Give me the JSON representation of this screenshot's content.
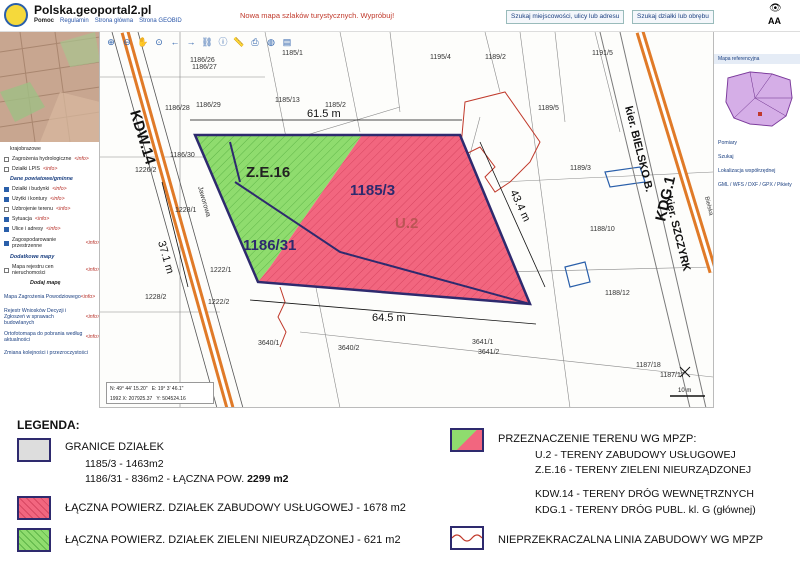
{
  "header": {
    "site_title": "Polska.geoportal2.pl",
    "links": [
      "Pomoc",
      "Regulamin",
      "Strona główna",
      "Strona GEOBID"
    ],
    "promo": "Nowa mapa szlaków turystycznych. Wypróbuj!",
    "search_button": "Szukaj miejscowości, ulicy lub adresu",
    "parcel_button": "Szukaj działki lub obrębu",
    "font_size_label": "AA"
  },
  "left_panel": {
    "layers_above": [
      "krajobrazowe"
    ],
    "layers": [
      {
        "label": "Zagrożenia hydrologiczne",
        "info": "<info>",
        "checked": false
      },
      {
        "label": "Działki LPIS",
        "info": "<info>",
        "checked": false
      }
    ],
    "section_district": "Dane powiatowe/gminne",
    "district_layers": [
      {
        "label": "Działki i budynki",
        "info": "<info>",
        "checked": true
      },
      {
        "label": "Użytki i kontury",
        "info": "<info>",
        "checked": true
      },
      {
        "label": "Uzbrojenie terenu",
        "info": "<info>",
        "checked": false
      },
      {
        "label": "Sytuacja",
        "info": "<info>",
        "checked": true
      },
      {
        "label": "Ulice i adresy",
        "info": "<info>",
        "checked": true
      },
      {
        "label": "Zagospodarowanie przestrzenne",
        "info": "<info>",
        "checked": true
      }
    ],
    "section_extra": "Dodatkowe mapy",
    "extra_layers": [
      {
        "label": "Mapa rejestru cen nieruchomości",
        "info": "<info>",
        "checked": false
      }
    ],
    "add_map_label": "Dodaj mapę",
    "links": [
      {
        "label": "Mapa Zagrożenia Powodziowego",
        "info": "<info>"
      },
      {
        "label": "Rejestr Wniosków Decyzji i Zgłoszeń w sprawach budowlanych",
        "info": "<info>"
      },
      {
        "label": "Ortofotomapa do pobrania według aktualności",
        "info": "<info>"
      }
    ],
    "footer_link": "Zmiana kolejności i przezroczystości"
  },
  "map": {
    "parcels": [
      "1185/3",
      "1186/31"
    ],
    "zone_labels": [
      "Z.E.16",
      "U.2"
    ],
    "streets": [
      "KDW.14",
      "KDG.1",
      "kier. BIELSKO B.",
      "kier. SZCZYRK",
      "Jaworowa",
      "Bielska"
    ],
    "dimensions": [
      "61.5 m",
      "37.1 m",
      "43.4 m",
      "64.5 m"
    ],
    "other_parcels": [
      "1186/26",
      "1186/27",
      "1185/1",
      "1195/4",
      "1189/2",
      "1191/5",
      "1186/29",
      "1186/28",
      "1185/2",
      "1189/5",
      "1226/2",
      "1189/3",
      "1188/10",
      "1188/12",
      "1228/2",
      "1222/2",
      "3640/1",
      "3640/2",
      "3641/2",
      "1187/18",
      "1187/17",
      "3641/1",
      "1185/13",
      "1186/30",
      "1228/1",
      "1222/1"
    ],
    "scale_label": "10 m",
    "coords": {
      "n_label": "N:",
      "n": "49° 44' 15.20\"",
      "e_label": "E:",
      "e": "19° 3' 46.1\"",
      "x_label": "X:",
      "x": "207925.37",
      "y_label": "Y:",
      "y": "504524.16",
      "epsg": "1992"
    }
  },
  "right_panel": {
    "reference_map": "Mapa referencyjna",
    "menu": [
      "Pomiary",
      "Szukaj",
      "Lokalizacja współrzędnej"
    ],
    "export": "GML / WFS / DXF / GPX / Pikiety"
  },
  "legend": {
    "title": "LEGENDA:",
    "boundaries_title": "GRANICE DZIAŁEK",
    "parcel_1": "1185/3 - 1463m2",
    "parcel_2_prefix": "1186/31 - 836m2 - ŁĄCZNA POW.",
    "parcel_2_total": "2299 m2",
    "service_area": "ŁĄCZNA POWIERZ. DZIAŁEK ZABUDOWY USŁUGOWEJ - 1678 m2",
    "green_area": "ŁĄCZNA POWIERZ. DZIAŁEK ZIELENI NIEURZĄDZONEJ - 621 m2",
    "zoning_title": "PRZEZNACZENIE TERENU WG MPZP:",
    "zoning_u2": "U.2 - TERENY ZABUDOWY USŁUGOWEJ",
    "zoning_ze16": "Z.E.16 - TERENY ZIELENI NIEURZĄDZONEJ",
    "kdw": "KDW.14 - TERENY DRÓG WEWNĘTRZNYCH",
    "kdg": "KDG.1 - TERENY DRÓG PUBL. kl. G (głównej)",
    "building_line": "NIEPRZEKRACZALNA LINIA ZABUDOWY WG MPZP"
  },
  "colors": {
    "pink": "#f2667f",
    "green": "#8fdc6e",
    "boundary": "#2e2a6e",
    "road": "#e07a28"
  }
}
